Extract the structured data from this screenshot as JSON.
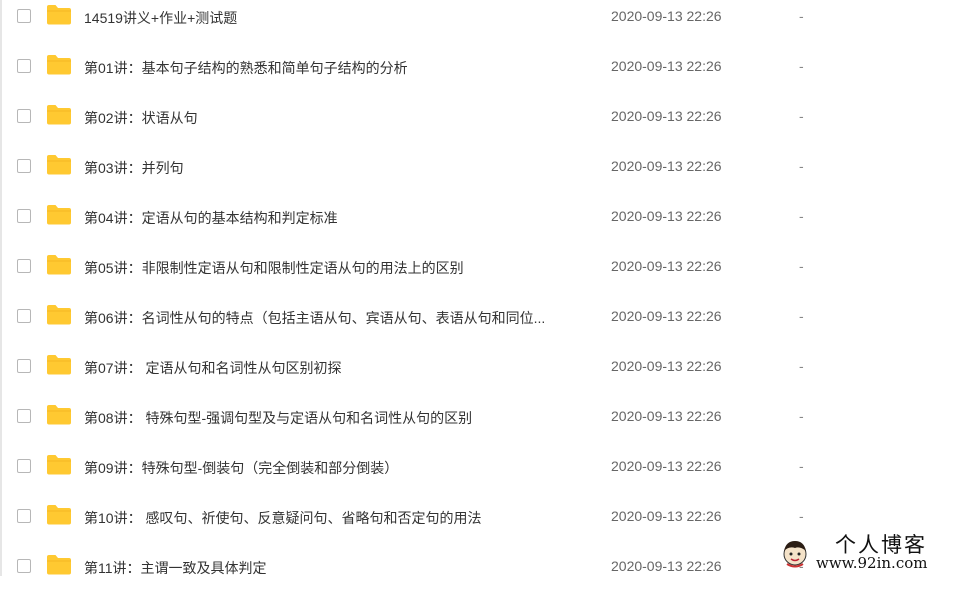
{
  "files": [
    {
      "name": "14519讲义+作业+测试题",
      "date": "2020-09-13 22:26",
      "size": "-"
    },
    {
      "name": "第01讲：基本句子结构的熟悉和简单句子结构的分析",
      "date": "2020-09-13 22:26",
      "size": "-"
    },
    {
      "name": "第02讲：状语从句",
      "date": "2020-09-13 22:26",
      "size": "-"
    },
    {
      "name": "第03讲：并列句",
      "date": "2020-09-13 22:26",
      "size": "-"
    },
    {
      "name": "第04讲：定语从句的基本结构和判定标准",
      "date": "2020-09-13 22:26",
      "size": "-"
    },
    {
      "name": "第05讲：非限制性定语从句和限制性定语从句的用法上的区别",
      "date": "2020-09-13 22:26",
      "size": "-"
    },
    {
      "name": "第06讲：名词性从句的特点（包括主语从句、宾语从句、表语从句和同位...",
      "date": "2020-09-13 22:26",
      "size": "-"
    },
    {
      "name": "第07讲： 定语从句和名词性从句区别初探",
      "date": "2020-09-13 22:26",
      "size": "-"
    },
    {
      "name": "第08讲： 特殊句型-强调句型及与定语从句和名词性从句的区别",
      "date": "2020-09-13 22:26",
      "size": "-"
    },
    {
      "name": "第09讲：特殊句型-倒装句（完全倒装和部分倒装）",
      "date": "2020-09-13 22:26",
      "size": "-"
    },
    {
      "name": "第10讲： 感叹句、祈使句、反意疑问句、省略句和否定句的用法",
      "date": "2020-09-13 22:26",
      "size": "-"
    },
    {
      "name": "第11讲：主谓一致及具体判定",
      "date": "2020-09-13 22:26",
      "size": "-"
    }
  ],
  "folder_icon": "folder-icon",
  "folder_color": "#ffc931",
  "watermark": {
    "title": "个人博客",
    "url": "www.92in.com"
  }
}
